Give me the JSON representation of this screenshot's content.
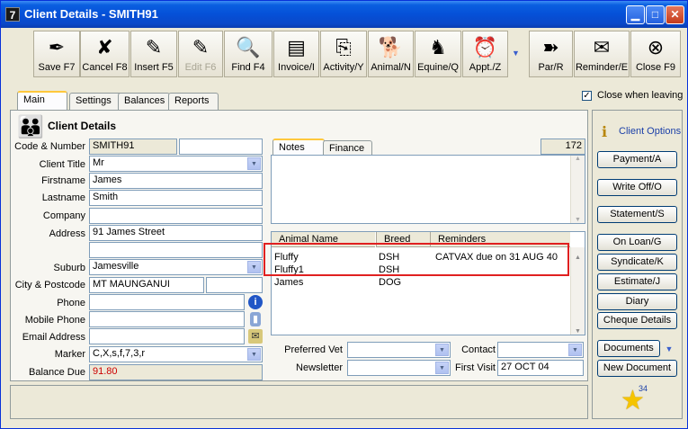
{
  "window": {
    "title": "Client Details - SMITH91",
    "app_icon": "7"
  },
  "toolbar": [
    {
      "name": "save",
      "label": "Save F7",
      "icon": "pen-icon",
      "glyph": "✒",
      "disabled": false
    },
    {
      "name": "cancel",
      "label": "Cancel F8",
      "icon": "cancel-x-icon",
      "glyph": "✘",
      "disabled": false
    },
    {
      "name": "insert",
      "label": "Insert F5",
      "icon": "insert-pen-icon",
      "glyph": "✎",
      "disabled": false
    },
    {
      "name": "edit",
      "label": "Edit F6",
      "icon": "edit-icon",
      "glyph": "✎",
      "disabled": true
    },
    {
      "name": "find",
      "label": "Find F4",
      "icon": "magnifier-icon",
      "glyph": "🔍",
      "disabled": false
    },
    {
      "name": "invoice",
      "label": "Invoice/I",
      "icon": "invoice-icon",
      "glyph": "▤",
      "disabled": false
    },
    {
      "name": "activity",
      "label": "Activity/Y",
      "icon": "activity-icon",
      "glyph": "⎘",
      "disabled": false
    },
    {
      "name": "animal",
      "label": "Animal/N",
      "icon": "dog-icon",
      "glyph": "🐕",
      "disabled": false
    },
    {
      "name": "equine",
      "label": "Equine/Q",
      "icon": "horse-icon",
      "glyph": "♞",
      "disabled": false
    },
    {
      "name": "appt",
      "label": "Appt./Z",
      "icon": "alarm-clock-icon",
      "glyph": "⏰",
      "disabled": false
    },
    {
      "name": "par",
      "label": "Par/R",
      "icon": "par-icon",
      "glyph": "➽",
      "disabled": false
    },
    {
      "name": "reminder",
      "label": "Reminder/E",
      "icon": "reminder-icon",
      "glyph": "✉",
      "disabled": false
    },
    {
      "name": "close",
      "label": "Close F9",
      "icon": "close-circle-icon",
      "glyph": "⊗",
      "disabled": false
    }
  ],
  "tabs": [
    "Main",
    "Settings",
    "Balances",
    "Reports"
  ],
  "close_when_leaving": "Close when leaving",
  "client": {
    "heading": "Client Details",
    "labels": {
      "code": "Code & Number",
      "title": "Client Title",
      "firstname": "Firstname",
      "lastname": "Lastname",
      "company": "Company",
      "address": "Address",
      "suburb": "Suburb",
      "city": "City & Postcode",
      "phone": "Phone",
      "mobile": "Mobile Phone",
      "email": "Email Address",
      "marker": "Marker",
      "balance": "Balance Due"
    },
    "values": {
      "code": "SMITH91",
      "number": "",
      "title": "Mr",
      "firstname": "James",
      "lastname": "Smith",
      "company": "",
      "address1": "91 James Street",
      "address2": "",
      "suburb": "Jamesville",
      "city": "MT MAUNGANUI",
      "postcode": "",
      "phone": "",
      "mobile": "",
      "email": "",
      "marker": "C,X,s,f,7,3,r",
      "balance": "91.80"
    }
  },
  "notes_tabs": [
    "Notes",
    "Finance"
  ],
  "notes_count": "172",
  "animals": {
    "headers": [
      "Animal Name",
      "Breed",
      "Reminders"
    ],
    "rows": [
      {
        "name": "Fluffy",
        "breed": "DSH",
        "reminder": "CATVAX due on 31 AUG 40"
      },
      {
        "name": "Fluffy1",
        "breed": "DSH",
        "reminder": ""
      },
      {
        "name": "James",
        "breed": "DOG",
        "reminder": ""
      }
    ]
  },
  "bottom": {
    "preferred_vet_label": "Preferred Vet",
    "preferred_vet": "",
    "newsletter_label": "Newsletter",
    "newsletter": "",
    "contact_label": "Contact",
    "contact": "",
    "first_visit_label": "First Visit",
    "first_visit": "27 OCT 04"
  },
  "options": {
    "heading": "Client Options",
    "buttons": [
      "Payment/A",
      "Write Off/O",
      "Statement/S",
      "On Loan/G",
      "Syndicate/K",
      "Estimate/J",
      "Diary",
      "Cheque Details",
      "Documents",
      "New Document"
    ],
    "star_count": "34"
  },
  "colors": {
    "balance": "#CC0000",
    "highlight": "#E02020"
  }
}
